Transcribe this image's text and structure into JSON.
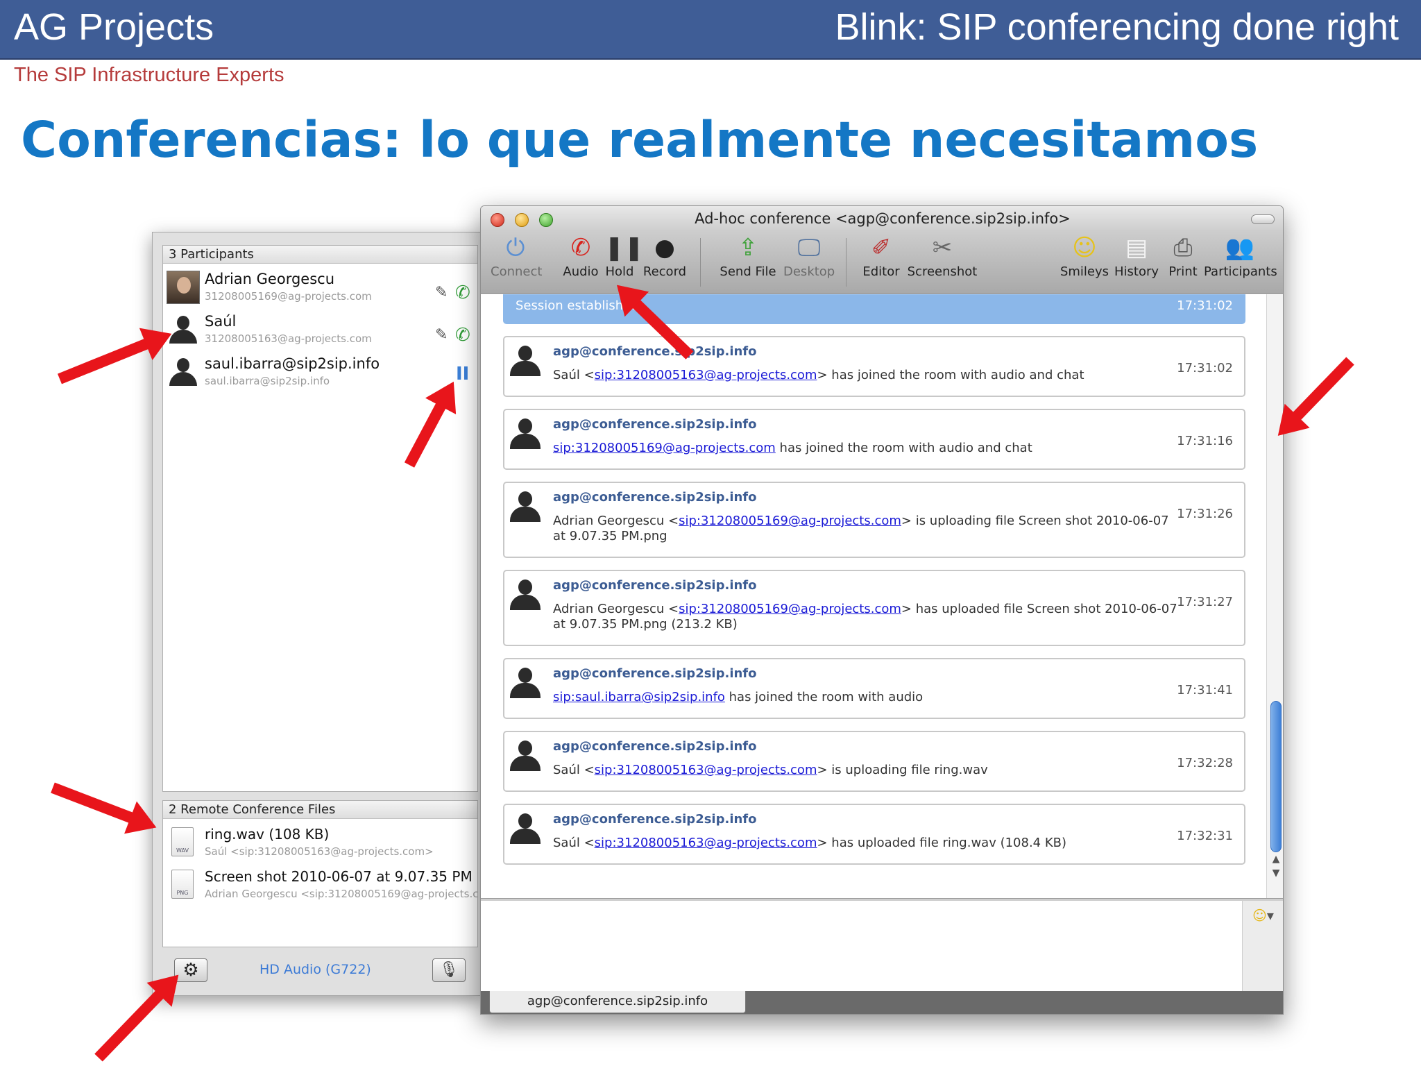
{
  "slide": {
    "org": "AG Projects",
    "title": "Blink: SIP conferencing done right",
    "tagline": "The SIP Infrastructure Experts",
    "heading": "Conferencias: lo que realmente necesitamos"
  },
  "drawer": {
    "participants_header": "3 Participants",
    "participants": [
      {
        "name": "Adrian Georgescu",
        "uri": "31208005169@ag-projects.com",
        "avatar": "photo",
        "icons": [
          "pencil-icon",
          "phone-icon"
        ]
      },
      {
        "name": "Saúl",
        "uri": "31208005163@ag-projects.com",
        "avatar": "silhouette",
        "icons": [
          "pencil-icon",
          "phone-icon"
        ]
      },
      {
        "name": "saul.ibarra@sip2sip.info",
        "uri": "saul.ibarra@sip2sip.info",
        "avatar": "silhouette",
        "icons": [
          "hold-icon"
        ]
      }
    ],
    "files_header": "2 Remote Conference Files",
    "files": [
      {
        "name": "ring.wav (108 KB)",
        "sender": "Saúl <sip:31208005163@ag-projects.com>",
        "type": "WAV"
      },
      {
        "name": "Screen shot 2010-06-07 at 9.07.35 PM",
        "sender": "Adrian Georgescu <sip:31208005169@ag-projects.c",
        "type": "PNG"
      }
    ],
    "codec": "HD Audio (G722)"
  },
  "window": {
    "title": "Ad-hoc conference <agp@conference.sip2sip.info>",
    "toolbar": [
      {
        "label": "Connect",
        "icon": "power-icon",
        "enabled": false
      },
      {
        "label": "Audio",
        "icon": "phone-icon",
        "enabled": true
      },
      {
        "label": "Hold",
        "icon": "pause-icon",
        "enabled": true
      },
      {
        "label": "Record",
        "icon": "record-icon",
        "enabled": true
      },
      {
        "label": "Send File",
        "icon": "send-file-icon",
        "enabled": true
      },
      {
        "label": "Desktop",
        "icon": "monitor-icon",
        "enabled": false
      },
      {
        "label": "Editor",
        "icon": "editor-icon",
        "enabled": true
      },
      {
        "label": "Screenshot",
        "icon": "screenshot-icon",
        "enabled": true
      },
      {
        "label": "Smileys",
        "icon": "smiley-icon",
        "enabled": true
      },
      {
        "label": "History",
        "icon": "history-icon",
        "enabled": true
      },
      {
        "label": "Print",
        "icon": "printer-icon",
        "enabled": true
      },
      {
        "label": "Participants",
        "icon": "participants-icon",
        "enabled": true
      }
    ],
    "status": {
      "text": "Session established",
      "time": "17:31:02"
    },
    "messages": [
      {
        "sender": "agp@conference.sip2sip.info",
        "pre": "Saúl <",
        "link": "sip:31208005163@ag-projects.com",
        "post": "> has joined the room with audio and chat",
        "time": "17:31:02"
      },
      {
        "sender": "agp@conference.sip2sip.info",
        "pre": "",
        "link": "sip:31208005169@ag-projects.com",
        "post": " has joined the room with audio and chat",
        "time": "17:31:16"
      },
      {
        "sender": "agp@conference.sip2sip.info",
        "pre": "Adrian Georgescu <",
        "link": "sip:31208005169@ag-projects.com",
        "post": "> is uploading file Screen shot 2010-06-07 at 9.07.35 PM.png",
        "time": "17:31:26"
      },
      {
        "sender": "agp@conference.sip2sip.info",
        "pre": "Adrian Georgescu <",
        "link": "sip:31208005169@ag-projects.com",
        "post": "> has uploaded file Screen shot 2010-06-07 at 9.07.35 PM.png (213.2 KB)",
        "time": "17:31:27"
      },
      {
        "sender": "agp@conference.sip2sip.info",
        "pre": "",
        "link": "sip:saul.ibarra@sip2sip.info",
        "post": " has joined the room with audio",
        "time": "17:31:41"
      },
      {
        "sender": "agp@conference.sip2sip.info",
        "pre": "Saúl <",
        "link": "sip:31208005163@ag-projects.com",
        "post": "> is uploading file ring.wav",
        "time": "17:32:28"
      },
      {
        "sender": "agp@conference.sip2sip.info",
        "pre": "Saúl <",
        "link": "sip:31208005163@ag-projects.com",
        "post": "> has uploaded file ring.wav (108.4 KB)",
        "time": "17:32:31"
      }
    ],
    "tab": "agp@conference.sip2sip.info"
  },
  "colors": {
    "banner": "#3f5d96",
    "heading": "#1477c5",
    "tagline": "#b53b3b",
    "link": "#1a1ad6",
    "arrow": "#e8151b",
    "status_bar": "#8bb7e9"
  }
}
